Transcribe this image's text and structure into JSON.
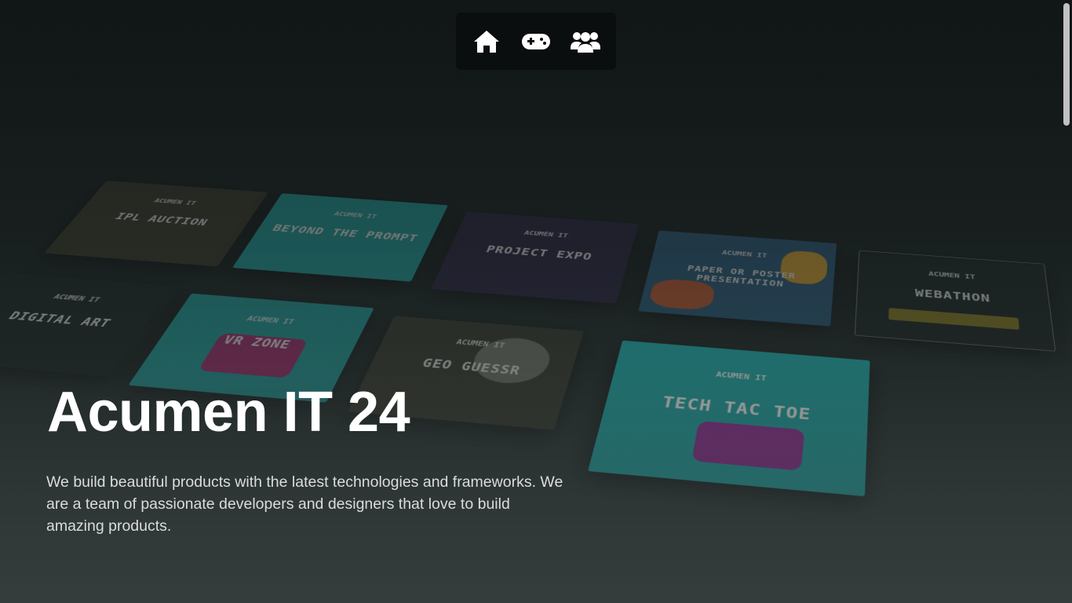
{
  "nav": {
    "items": [
      {
        "icon": "home-icon"
      },
      {
        "icon": "gamepad-icon"
      },
      {
        "icon": "users-icon"
      }
    ]
  },
  "hero": {
    "title": "Acumen IT 24",
    "description": "We build beautiful products with the latest technologies and frameworks. We are a team of passionate developers and designers that love to build amazing products."
  },
  "posters": [
    {
      "title": "IPL AUCTION",
      "header": "ACUMEN IT"
    },
    {
      "title": "BEYOND THE PROMPT",
      "header": "ACUMEN IT"
    },
    {
      "title": "PROJECT EXPO",
      "header": "ACUMEN IT"
    },
    {
      "title": "PAPER OR POSTER PRESENTATION",
      "header": "ACUMEN IT"
    },
    {
      "title": "WEBATHON",
      "header": "ACUMEN IT"
    },
    {
      "title": "DIGITAL ART",
      "header": "ACUMEN IT"
    },
    {
      "title": "VR ZONE",
      "header": "ACUMEN IT"
    },
    {
      "title": "GEO GUESSR",
      "header": "ACUMEN IT"
    },
    {
      "title": "TECH TAC TOE",
      "header": "ACUMEN IT"
    }
  ],
  "colors": {
    "teal": "#1f9c9a",
    "dark": "#1d2323",
    "navy": "#2b2440",
    "olive": "#3a3a2c"
  }
}
